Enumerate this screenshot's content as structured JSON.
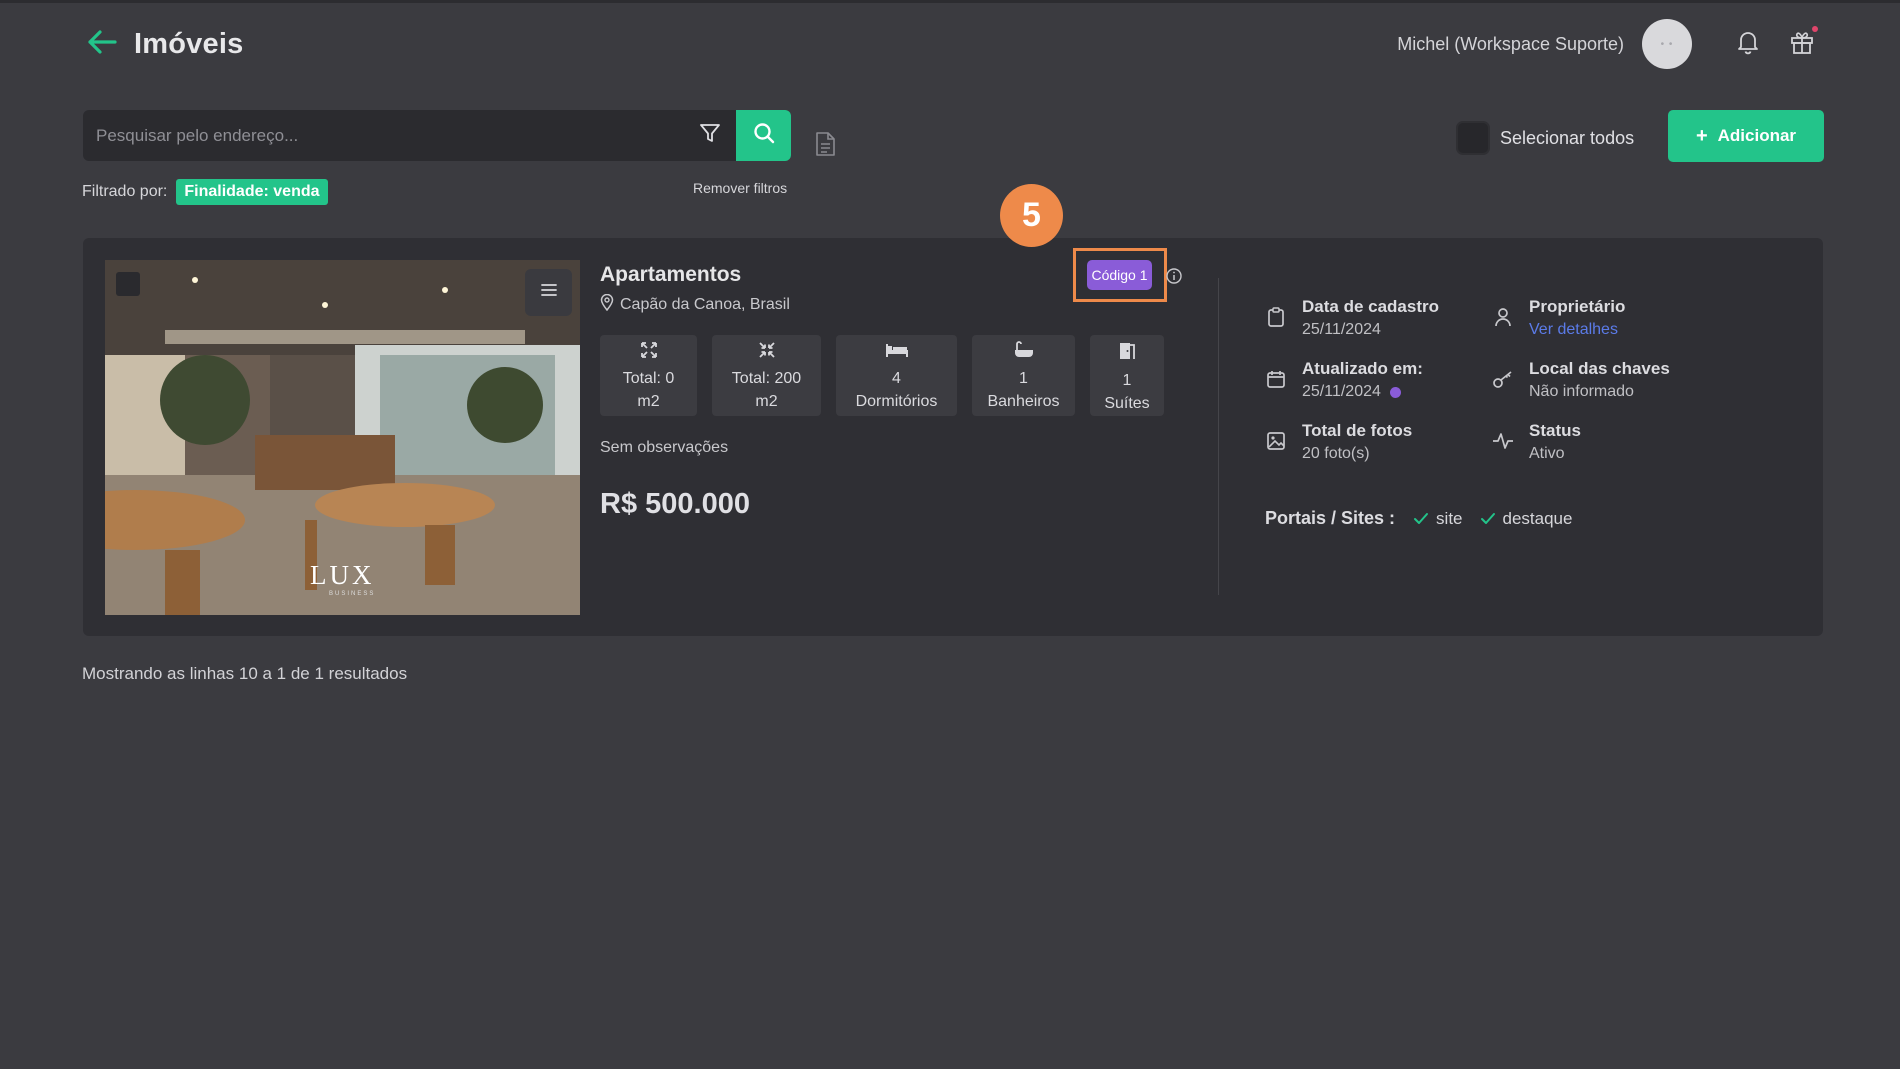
{
  "header": {
    "title": "Imóveis",
    "user_name": "Michel (Workspace Suporte)",
    "avatar_text": "• •"
  },
  "toolbar": {
    "search_placeholder": "Pesquisar pelo endereço...",
    "select_all_label": "Selecionar todos",
    "add_label": "Adicionar"
  },
  "filters": {
    "label": "Filtrado por:",
    "active": "Finalidade: venda",
    "remove_label": "Remover filtros"
  },
  "step_marker": "5",
  "property": {
    "photo_logo": "LUX",
    "photo_logo_sub": "BUSINESS",
    "type": "Apartamentos",
    "location": "Capão da Canoa, Brasil",
    "code": "Código 1",
    "stats": [
      {
        "icon": "expand-icon",
        "line1": "Total: 0",
        "line2": "m2"
      },
      {
        "icon": "compress-icon",
        "line1": "Total: 200",
        "line2": "m2"
      },
      {
        "icon": "bed-icon",
        "line1": "4",
        "line2": "Dormitórios"
      },
      {
        "icon": "bathtub-icon",
        "line1": "1",
        "line2": "Banheiros"
      },
      {
        "icon": "door-icon",
        "line1": "1",
        "line2": "Suítes"
      }
    ],
    "observations": "Sem observações",
    "price": "R$ 500.000",
    "details": {
      "registered_label": "Data de cadastro",
      "registered_value": "25/11/2024",
      "owner_label": "Proprietário",
      "owner_link": "Ver detalhes",
      "updated_label": "Atualizado em:",
      "updated_value": "25/11/2024",
      "keys_label": "Local das chaves",
      "keys_value": "Não informado",
      "photos_label": "Total de fotos",
      "photos_value": "20 foto(s)",
      "status_label": "Status",
      "status_value": "Ativo"
    },
    "portals_label": "Portais / Sites :",
    "portals": [
      "site",
      "destaque"
    ]
  },
  "footer": {
    "results": "Mostrando as linhas 10 a 1 de 1 resultados"
  },
  "colors": {
    "accent": "#23c48a",
    "background": "#3b3b40",
    "card": "#2f2f34",
    "code_chip": "#8a5cd8",
    "step_marker": "#ee8a4a",
    "link": "#5b7be8"
  }
}
